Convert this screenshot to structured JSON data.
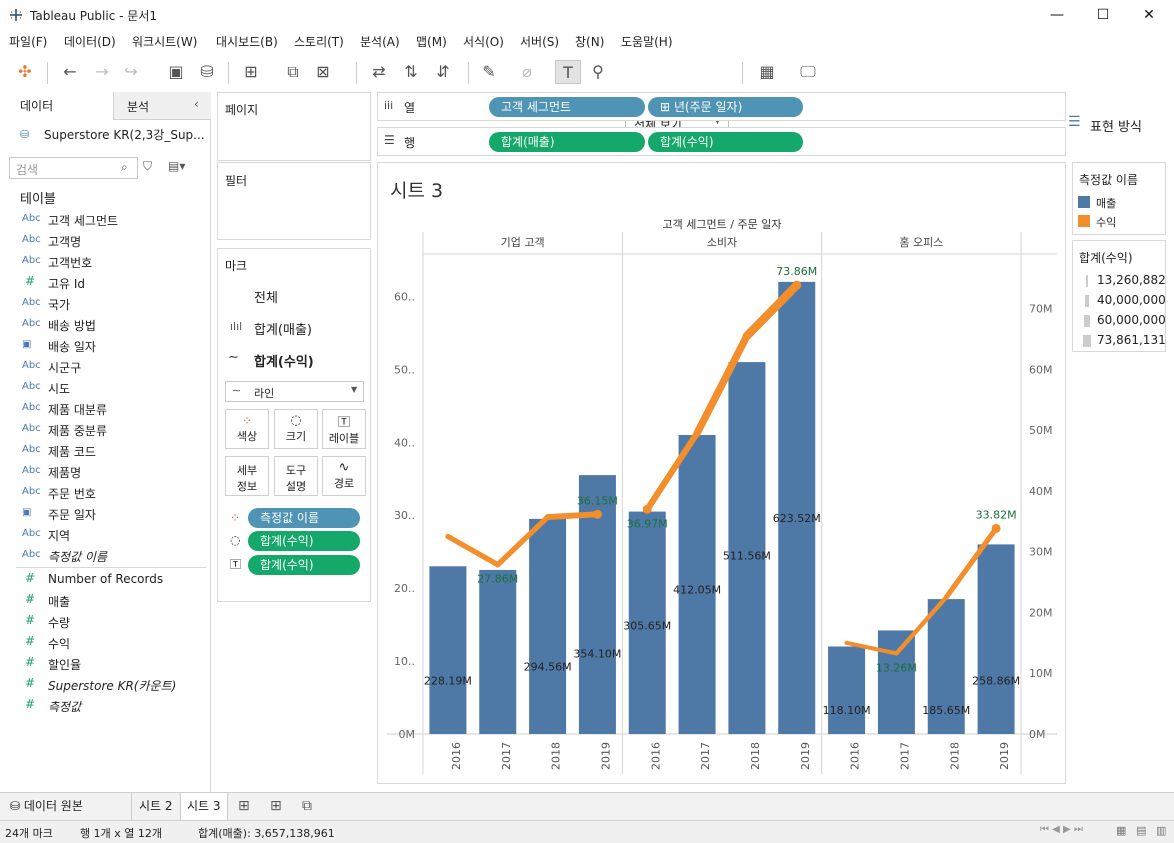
{
  "window": {
    "title": "Tableau Public - 문서1",
    "minimize": "—",
    "maximize": "☐",
    "close": "✕"
  },
  "menu": [
    "파일(F)",
    "데이터(D)",
    "워크시트(W)",
    "대시보드(B)",
    "스토리(T)",
    "분석(A)",
    "맵(M)",
    "서식(O)",
    "서버(S)",
    "창(N)",
    "도움말(H)"
  ],
  "toolbar": {
    "view_select": "전체 보기",
    "show_me": "표현 방식"
  },
  "left_pane": {
    "tab_data": "데이터",
    "tab_analysis": "분석",
    "datasource": "Superstore KR(2,3강_Sup...",
    "search_placeholder": "검색",
    "tables_header": "테이블",
    "dimensions": [
      {
        "type": "Abc",
        "name": "고객 세그먼트"
      },
      {
        "type": "Abc",
        "name": "고객명"
      },
      {
        "type": "Abc",
        "name": "고객번호"
      },
      {
        "type": "#",
        "name": "고유 Id"
      },
      {
        "type": "Abc",
        "name": "국가"
      },
      {
        "type": "Abc",
        "name": "배송 방법"
      },
      {
        "type": "date",
        "name": "배송 일자"
      },
      {
        "type": "Abc",
        "name": "시군구"
      },
      {
        "type": "Abc",
        "name": "시도"
      },
      {
        "type": "Abc",
        "name": "제품 대분류"
      },
      {
        "type": "Abc",
        "name": "제품 중분류"
      },
      {
        "type": "Abc",
        "name": "제품 코드"
      },
      {
        "type": "Abc",
        "name": "제품명"
      },
      {
        "type": "Abc",
        "name": "주문 번호"
      },
      {
        "type": "date",
        "name": "주문 일자"
      },
      {
        "type": "Abc",
        "name": "지역"
      },
      {
        "type": "Abc",
        "name": "측정값 이름"
      }
    ],
    "measures": [
      {
        "type": "#",
        "name": "Number of Records"
      },
      {
        "type": "#",
        "name": "매출"
      },
      {
        "type": "#",
        "name": "수량"
      },
      {
        "type": "#",
        "name": "수익"
      },
      {
        "type": "#",
        "name": "할인율"
      },
      {
        "type": "#",
        "name": "Superstore KR(카운트)"
      },
      {
        "type": "#",
        "name": "측정값"
      }
    ]
  },
  "pages_card": {
    "title": "페이지"
  },
  "filters_card": {
    "title": "필터"
  },
  "marks_card": {
    "title": "마크",
    "all": "전체",
    "sales_layer": "합계(매출)",
    "profit_layer": "합계(수익)",
    "mark_type": "라인",
    "buttons": {
      "color": "색상",
      "size": "크기",
      "label": "레이블",
      "detail_1": "세부",
      "detail_2": "정보",
      "tooltip_1": "도구",
      "tooltip_2": "설명",
      "path": "경로"
    },
    "pill_color": "측정값 이름",
    "pill_size": "합계(수익)",
    "pill_label": "합계(수익)"
  },
  "columns_shelf": {
    "label": "열",
    "pills": [
      "고객 세그먼트",
      "⊞ 년(주문 일자)"
    ]
  },
  "rows_shelf": {
    "label": "행",
    "pills": [
      "합계(매출)",
      "합계(수익)"
    ]
  },
  "legend_color": {
    "title": "측정값 이름",
    "items": [
      {
        "name": "매출",
        "color": "#4e79a7"
      },
      {
        "name": "수익",
        "color": "#f28e2b"
      }
    ]
  },
  "legend_size": {
    "title": "합계(수익)",
    "items": [
      "13,260,882",
      "40,000,000",
      "60,000,000",
      "73,861,131"
    ]
  },
  "sheet": {
    "title": "시트 3",
    "header": "고객 세그먼트 / 주문 일자",
    "left_axis_ticks": [
      "0M",
      "10..",
      "20..",
      "30..",
      "40..",
      "50..",
      "60.."
    ],
    "right_axis_ticks": [
      "0M",
      "10M",
      "20M",
      "30M",
      "40M",
      "50M",
      "60M",
      "70M"
    ]
  },
  "chart_data": {
    "type": "bar",
    "title": "시트 3",
    "header": "고객 세그먼트 / 주문 일자",
    "segments": [
      "기업 고객",
      "소비자",
      "홈 오피스"
    ],
    "x": [
      "2016",
      "2017",
      "2018",
      "2019"
    ],
    "left_axis": {
      "measure": "매출",
      "range_M": [
        0,
        65
      ]
    },
    "right_axis": {
      "measure": "수익",
      "range_M": [
        0,
        78
      ]
    },
    "series": [
      {
        "name": "매출",
        "type": "bar",
        "color": "#4e79a7",
        "values_M": [
          [
            23,
            22.5,
            29.5,
            35.5
          ],
          [
            30.5,
            41,
            51,
            62
          ],
          [
            12,
            14.2,
            18.5,
            26
          ]
        ],
        "labels": [
          [
            "228.19M",
            "",
            "294.56M",
            "354.10M"
          ],
          [
            "305.65M",
            "412.05M",
            "511.56M",
            "623.52M"
          ],
          [
            "118.10M",
            "",
            "185.65M",
            "258.86M"
          ]
        ]
      },
      {
        "name": "수익",
        "type": "line",
        "color": "#f28e2b",
        "values_M": [
          [
            32.5,
            27.86,
            35.7,
            36.15
          ],
          [
            36.97,
            49.5,
            65.5,
            73.86
          ],
          [
            15,
            13.26,
            22.5,
            33.82
          ]
        ],
        "labels": [
          [
            "",
            "27.86M",
            "",
            "36.15M"
          ],
          [
            "36.97M",
            "",
            "",
            "73.86M"
          ],
          [
            "",
            "13.26M",
            "",
            "33.82M"
          ]
        ]
      }
    ]
  },
  "sheet_tabs": {
    "datasource": "데이터 원본",
    "tabs": [
      "시트 2",
      "시트 3"
    ],
    "active": "시트 3"
  },
  "status": {
    "marks": "24개 마크",
    "rows_cols": "행 1개 x 열 12개",
    "sum": "합계(매출): 3,657,138,961"
  }
}
